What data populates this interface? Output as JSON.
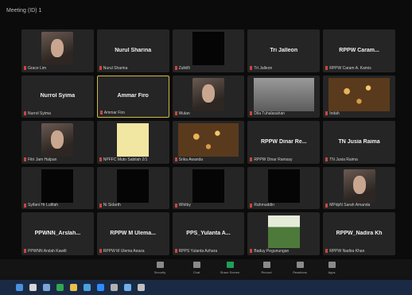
{
  "window": {
    "title": "Meeting (ID) 1"
  },
  "participants": [
    {
      "id": "p1",
      "name": "",
      "caption": "Grace Lim",
      "kind": "video"
    },
    {
      "id": "p2",
      "name": "Nurul Sharina",
      "caption": "Nurul Sharina",
      "kind": "name"
    },
    {
      "id": "p3",
      "name": "",
      "caption": "Zulkifli",
      "kind": "video-dark"
    },
    {
      "id": "p4",
      "name": "Tri Jalleon",
      "caption": "Tri Jalleon",
      "kind": "name"
    },
    {
      "id": "p5",
      "name": "RPPW Caram...",
      "caption": "RPPW Caram A. Kamis",
      "kind": "name"
    },
    {
      "id": "p6",
      "name": "Nurrol Syima",
      "caption": "Nurrol Syima",
      "kind": "name"
    },
    {
      "id": "p7",
      "name": "Ammar Firo",
      "caption": "Ammar Firo",
      "kind": "name",
      "active": true
    },
    {
      "id": "p8",
      "name": "",
      "caption": "Wulan",
      "kind": "video"
    },
    {
      "id": "p9",
      "name": "",
      "caption": "Dila Tuhalasahan",
      "kind": "video-grey"
    },
    {
      "id": "p10",
      "name": "",
      "caption": "Indah",
      "kind": "video-lights"
    },
    {
      "id": "p11",
      "name": "",
      "caption": "Fitri Jam Halpan",
      "kind": "video"
    },
    {
      "id": "p12",
      "name": "",
      "caption": "NPFFC Muto Sabilah 2/1",
      "kind": "video-note"
    },
    {
      "id": "p13",
      "name": "",
      "caption": "Srika Awanda",
      "kind": "video-lights"
    },
    {
      "id": "p14",
      "name": "RPPW Dinar Re...",
      "caption": "RPPW Dinar Ramsay",
      "kind": "name"
    },
    {
      "id": "p15",
      "name": "TN Jusia Raima",
      "caption": "TN Jusia Raima",
      "kind": "name"
    },
    {
      "id": "p16",
      "name": "",
      "caption": "Syifani Hr Lutfiah",
      "kind": "video-dark"
    },
    {
      "id": "p17",
      "name": "",
      "caption": "Ni Sidarth",
      "kind": "video-dark"
    },
    {
      "id": "p18",
      "name": "",
      "caption": "Whitby",
      "kind": "video-dark"
    },
    {
      "id": "p19",
      "name": "",
      "caption": "Rahmuddin",
      "kind": "video-dark"
    },
    {
      "id": "p20",
      "name": "",
      "caption": "MPdpN Sarah Amanda",
      "kind": "video"
    },
    {
      "id": "p21",
      "name": "PPWNN_Arslah...",
      "caption": "PPWNN Arslah Kawilt",
      "kind": "name"
    },
    {
      "id": "p22",
      "name": "RPPW M Ulema...",
      "caption": "RPPW M Ulema Aeaza",
      "kind": "name"
    },
    {
      "id": "p23",
      "name": "PPS_Yulanta A...",
      "caption": "RPPS Yulanta Azhara",
      "kind": "name"
    },
    {
      "id": "p24",
      "name": "",
      "caption": "Baduy Pegunungan",
      "kind": "video-forest"
    },
    {
      "id": "p25",
      "name": "RPPW_Nadira Kh",
      "caption": "RPPW Nadira Khan",
      "kind": "name"
    }
  ],
  "toolbar": {
    "buttons": [
      {
        "id": "security",
        "label": "Security"
      },
      {
        "id": "chat",
        "label": "Chat"
      },
      {
        "id": "share",
        "label": "Share Screen"
      },
      {
        "id": "record",
        "label": "Record"
      },
      {
        "id": "reactions",
        "label": "Reactions"
      },
      {
        "id": "apps",
        "label": "Apps"
      }
    ]
  },
  "colors": {
    "active_speaker": "#cdbb47",
    "share_green": "#1f9f5a",
    "mic_red": "#c9473f",
    "taskbar": "#1a2a44"
  },
  "taskbar": {
    "icons": [
      "windows-icon",
      "search-icon",
      "task-view-icon",
      "chrome-icon",
      "file-explorer-icon",
      "mail-icon",
      "zoom-icon",
      "settings-icon",
      "store-icon",
      "app-icon"
    ]
  }
}
